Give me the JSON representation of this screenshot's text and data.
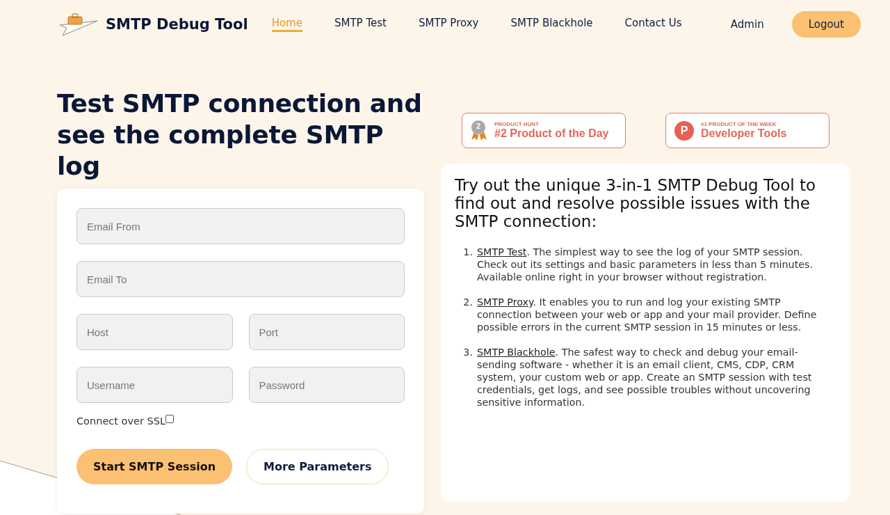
{
  "header": {
    "brand": "SMTP Debug Tool",
    "nav": [
      {
        "label": "Home",
        "selected": true
      },
      {
        "label": "SMTP Test",
        "selected": false
      },
      {
        "label": "SMTP Proxy",
        "selected": false
      },
      {
        "label": "SMTP Blackhole",
        "selected": false
      },
      {
        "label": "Contact Us",
        "selected": false
      }
    ],
    "user": "Admin",
    "logout": "Logout"
  },
  "hero": {
    "title": "Test SMTP connection and see the complete SMTP log"
  },
  "badges": [
    {
      "kind": "medal",
      "medal_number": "2",
      "caption": "PRODUCT HUNT",
      "title": "#2 Product of the Day"
    },
    {
      "kind": "logo",
      "logo_letter": "P",
      "caption": "#1 PRODUCT OF THE WEEK",
      "title": "Developer Tools"
    }
  ],
  "form": {
    "rows": [
      [
        {
          "placeholder": "Email From"
        }
      ],
      [
        {
          "placeholder": "Email To"
        }
      ],
      [
        {
          "placeholder": "Host"
        },
        {
          "placeholder": "Port"
        }
      ],
      [
        {
          "placeholder": "Username"
        },
        {
          "placeholder": "Password"
        }
      ]
    ],
    "ssl": {
      "label": "Connect over SSL",
      "checked": false
    },
    "primary_button": "Start SMTP Session",
    "secondary_button": "More Parameters"
  },
  "info": {
    "title": "Try out the unique 3-in-1 SMTP Debug Tool to find out and resolve possible issues with the SMTP connection:",
    "items": [
      {
        "number": "1.",
        "link": "SMTP Test",
        "text": ". The simplest way to see the log of your SMTP session. Check out its settings and basic parameters in less than 5 minutes. Available online right in your browser without registration."
      },
      {
        "number": "2.",
        "link": "SMTP Proxy",
        "text": ". It enables you to run and log your existing SMTP connection between your web or app and your mail provider. Define possible errors in the current SMTP session in 15 minutes or less."
      },
      {
        "number": "3.",
        "link": "SMTP Blackhole",
        "text": ". The safest way to check and debug your email-sending software - whether it is an email client, CMS, CDP, CRM system, your custom web or app. Create an SMTP session with test credentials, get logs, and see possible troubles without uncovering sensitive information."
      }
    ]
  }
}
